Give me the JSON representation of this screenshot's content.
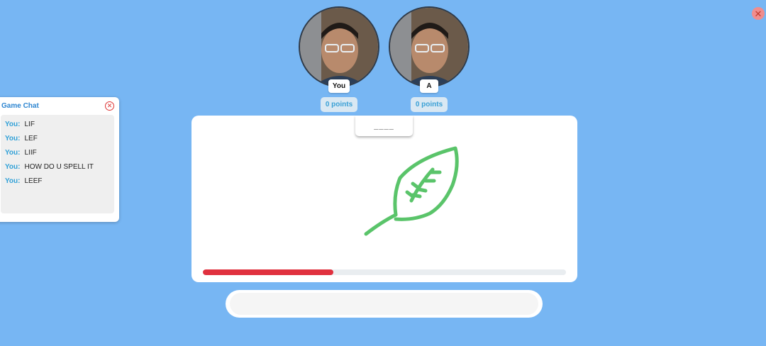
{
  "players": [
    {
      "name": "You",
      "points_label": "0 points"
    },
    {
      "name": "A",
      "points_label": "0 points"
    }
  ],
  "chat": {
    "title": "Game Chat",
    "messages": [
      {
        "sender": "You:",
        "text": "LIF"
      },
      {
        "sender": "You:",
        "text": "LEF"
      },
      {
        "sender": "You:",
        "text": "LIIF"
      },
      {
        "sender": "You:",
        "text": "HOW DO U SPELL IT"
      },
      {
        "sender": "You:",
        "text": "LEEF"
      }
    ]
  },
  "game": {
    "word_hint": "____",
    "timer_remaining_fraction": 0.36,
    "guess_placeholder": ""
  },
  "colors": {
    "background": "#77b6f3",
    "stroke": "#5ac46a",
    "timer": "#e0313f",
    "accent": "#2fa0d7"
  },
  "icons": {
    "close": "close-icon",
    "chat_close": "close-circle-icon"
  }
}
